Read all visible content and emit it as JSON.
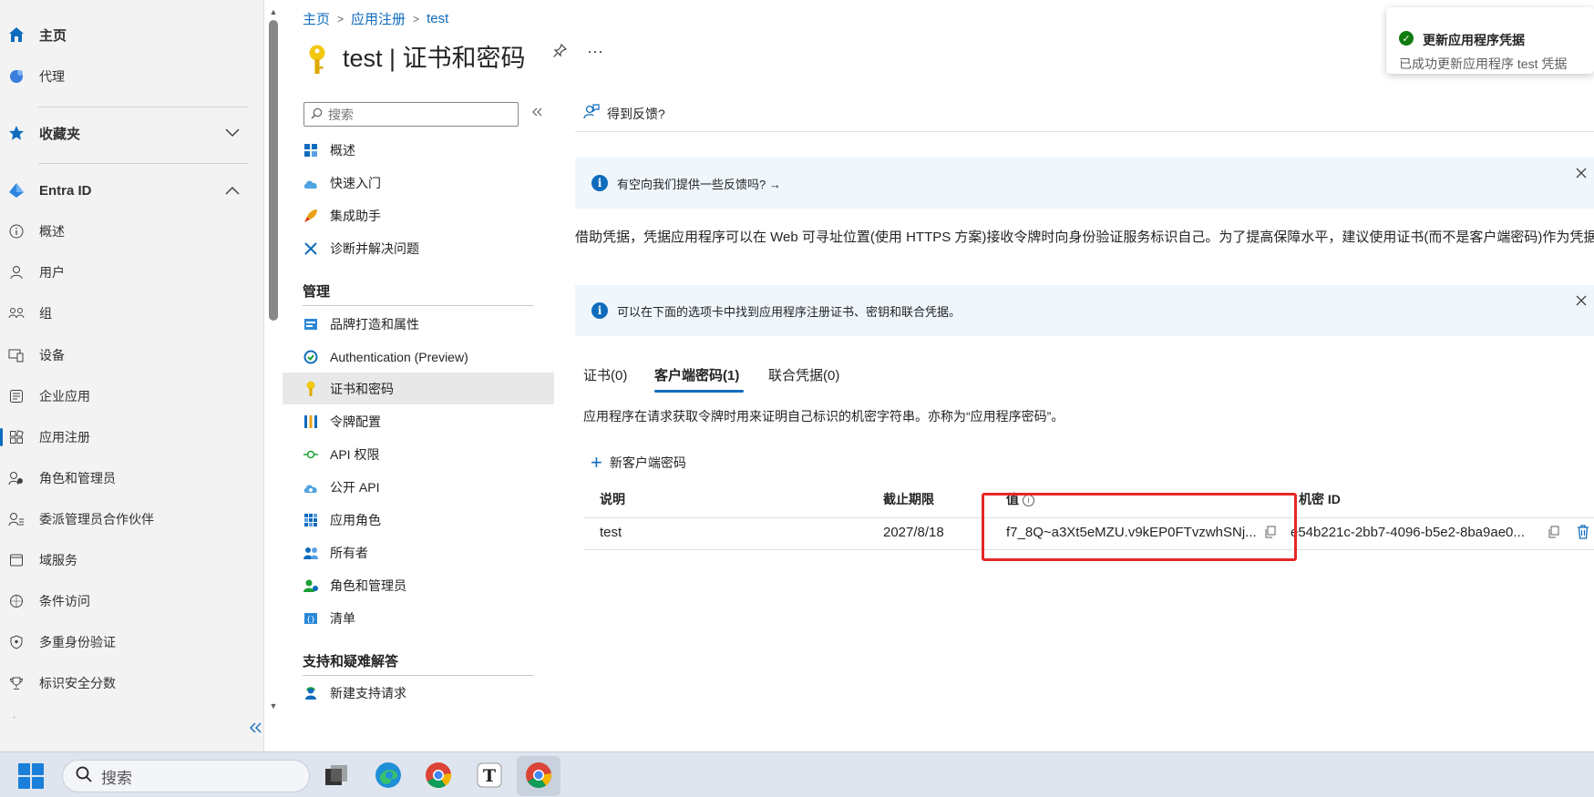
{
  "leftnav": {
    "home": "主页",
    "agent": "代理",
    "favorites": "收藏夹",
    "entra": "Entra ID",
    "items": [
      "概述",
      "用户",
      "组",
      "设备",
      "企业应用",
      "应用注册",
      "角色和管理员",
      "委派管理员合作伙伴",
      "域服务",
      "条件访问",
      "多重身份验证",
      "标识安全分数"
    ]
  },
  "breadcrumb": [
    "主页",
    "应用注册",
    "test"
  ],
  "page": {
    "title": "test | 证书和密码"
  },
  "menu": {
    "search_placeholder": "搜索",
    "top_items": [
      "概述",
      "快速入门",
      "集成助手",
      "诊断并解决问题"
    ],
    "section_manage": "管理",
    "manage_items": [
      "品牌打造和属性",
      "Authentication (Preview)",
      "证书和密码",
      "令牌配置",
      "API 权限",
      "公开 API",
      "应用角色",
      "所有者",
      "角色和管理员",
      "清单"
    ],
    "section_support": "支持和疑难解答",
    "support_items": [
      "新建支持请求"
    ]
  },
  "content": {
    "feedback": "得到反馈?",
    "banner1": "有空向我们提供一些反馈吗? →",
    "description": "借助凭据，凭据应用程序可以在 Web 可寻址位置(使用 HTTPS 方案)接收令牌时向身份验证服务标识自己。为了提高保障水平，建议使用证书(而不是客户端密码)作为凭据。",
    "banner2": "可以在下面的选项卡中找到应用程序注册证书、密钥和联合凭据。",
    "tabs": [
      "证书(0)",
      "客户端密码(1)",
      "联合凭据(0)"
    ],
    "tab_description": "应用程序在请求获取令牌时用来证明自己标识的机密字符串。亦称为“应用程序密码”。",
    "new_secret": "新客户端密码",
    "table": {
      "headers": [
        "说明",
        "截止期限",
        "值",
        "机密 ID"
      ],
      "rows": [
        {
          "description": "test",
          "expires": "2027/8/18",
          "value": "f7_8Q~a3Xt5eMZU.v9kEP0FTvzwhSNj...",
          "secret_id": "e54b221c-2bb7-4096-b5e2-8ba9ae0..."
        }
      ]
    }
  },
  "toast": {
    "title": "更新应用程序凭据",
    "message": "已成功更新应用程序 test 凭据"
  },
  "taskbar": {
    "search": "搜索"
  },
  "colors": {
    "accent": "#0f6cbd",
    "highlight": "#e52727",
    "success": "#107c10"
  }
}
